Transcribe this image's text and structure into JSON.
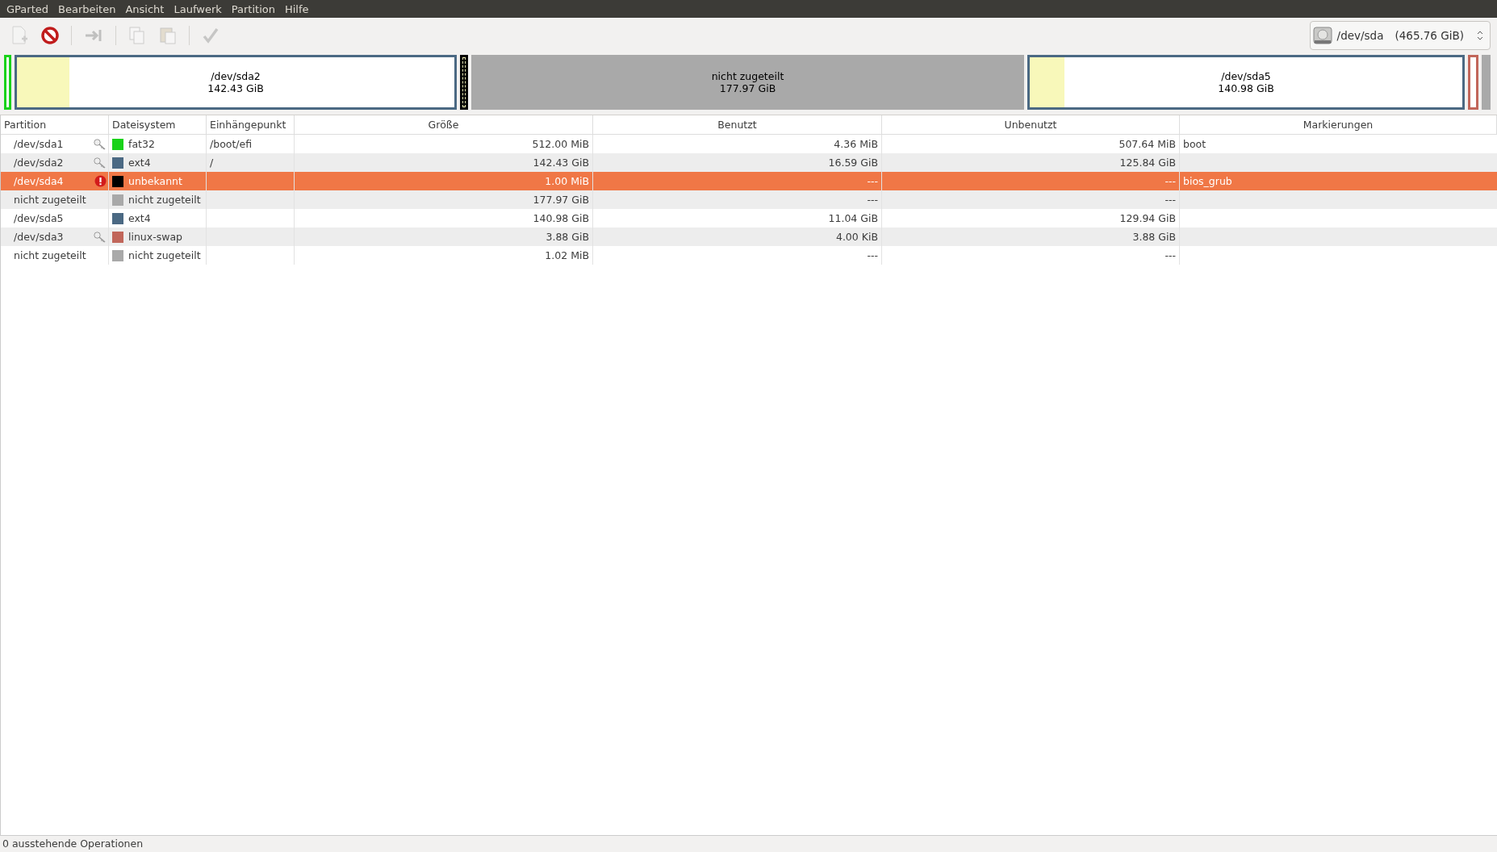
{
  "menu": [
    "GParted",
    "Bearbeiten",
    "Ansicht",
    "Laufwerk",
    "Partition",
    "Hilfe"
  ],
  "toolbar": [
    {
      "disabled": true
    },
    {
      "disabled": false
    },
    {
      "disabled": true
    },
    {
      "disabled": true
    },
    {
      "disabled": true
    },
    {
      "disabled": true
    }
  ],
  "device": {
    "name": "/dev/sda",
    "size": "(465.76 GiB)"
  },
  "disk_map": [
    {
      "kind": "partition",
      "color": "#19d219"
    },
    {
      "kind": "partition",
      "color": "#4b6983",
      "level": 0.12,
      "label": "/dev/sda2",
      "size": "142.43 GiB"
    },
    {
      "kind": "unknown"
    },
    {
      "kind": "unallocated",
      "label": "nicht zugeteilt",
      "size": "177.97 GiB"
    },
    {
      "kind": "partition",
      "color": "#4b6983",
      "level": 0.08,
      "label": "/dev/sda5",
      "size": "140.98 GiB"
    },
    {
      "kind": "partition",
      "color": "#c1665a"
    },
    {
      "kind": "unallocated"
    }
  ],
  "table": {
    "columns": [
      "Partition",
      "Dateisystem",
      "Einhängepunkt",
      "Größe",
      "Benutzt",
      "Unbenutzt",
      "Markierungen"
    ],
    "rows": [
      {
        "partition": "/dev/sda1",
        "mounted": true,
        "error": false,
        "filesystem": "fat32",
        "color": "#19d219",
        "mountpoint": "/boot/efi",
        "size": "512.00 MiB",
        "used": "4.36 MiB",
        "unused": "507.64 MiB",
        "flags": "boot",
        "selected": false
      },
      {
        "partition": "/dev/sda2",
        "mounted": true,
        "error": false,
        "filesystem": "ext4",
        "color": "#4b6983",
        "mountpoint": "/",
        "size": "142.43 GiB",
        "used": "16.59 GiB",
        "unused": "125.84 GiB",
        "selected": false
      },
      {
        "partition": "/dev/sda4",
        "mounted": false,
        "error": true,
        "filesystem": "unbekannt",
        "color": "#000000",
        "size": "1.00 MiB",
        "used": "---",
        "unused": "---",
        "flags": "bios_grub",
        "selected": true
      },
      {
        "partition": "nicht zugeteilt",
        "mounted": false,
        "error": false,
        "filesystem": "nicht zugeteilt",
        "color": "#a9a9a9",
        "size": "177.97 GiB",
        "used": "---",
        "unused": "---",
        "selected": false
      },
      {
        "partition": "/dev/sda5",
        "mounted": false,
        "error": false,
        "filesystem": "ext4",
        "color": "#4b6983",
        "size": "140.98 GiB",
        "used": "11.04 GiB",
        "unused": "129.94 GiB",
        "selected": false
      },
      {
        "partition": "/dev/sda3",
        "mounted": true,
        "error": false,
        "filesystem": "linux-swap",
        "color": "#c1665a",
        "size": "3.88 GiB",
        "used": "4.00 KiB",
        "unused": "3.88 GiB",
        "selected": false
      },
      {
        "partition": "nicht zugeteilt",
        "mounted": false,
        "error": false,
        "filesystem": "nicht zugeteilt",
        "color": "#a9a9a9",
        "size": "1.02 MiB",
        "used": "---",
        "unused": "---",
        "selected": false
      }
    ]
  },
  "status_bar": "0 ausstehende Operationen"
}
